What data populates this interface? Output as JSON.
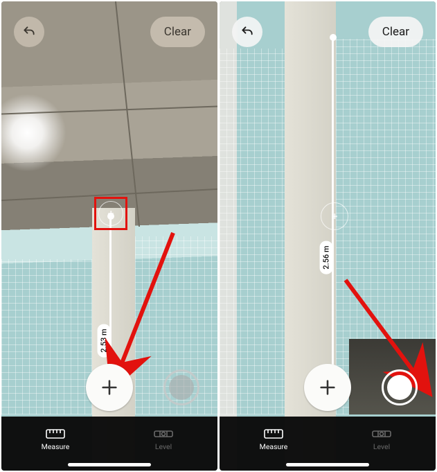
{
  "left": {
    "undo_icon": "undo-icon",
    "clear_label": "Clear",
    "measurement_label": "2.53 m",
    "tabs": {
      "measure": "Measure",
      "level": "Level"
    }
  },
  "right": {
    "undo_icon": "undo-icon",
    "clear_label": "Clear",
    "measurement_label": "2.56 m",
    "tabs": {
      "measure": "Measure",
      "level": "Level"
    }
  },
  "colors": {
    "annotation_red": "#e2120e",
    "tabbar_bg": "#080808"
  }
}
